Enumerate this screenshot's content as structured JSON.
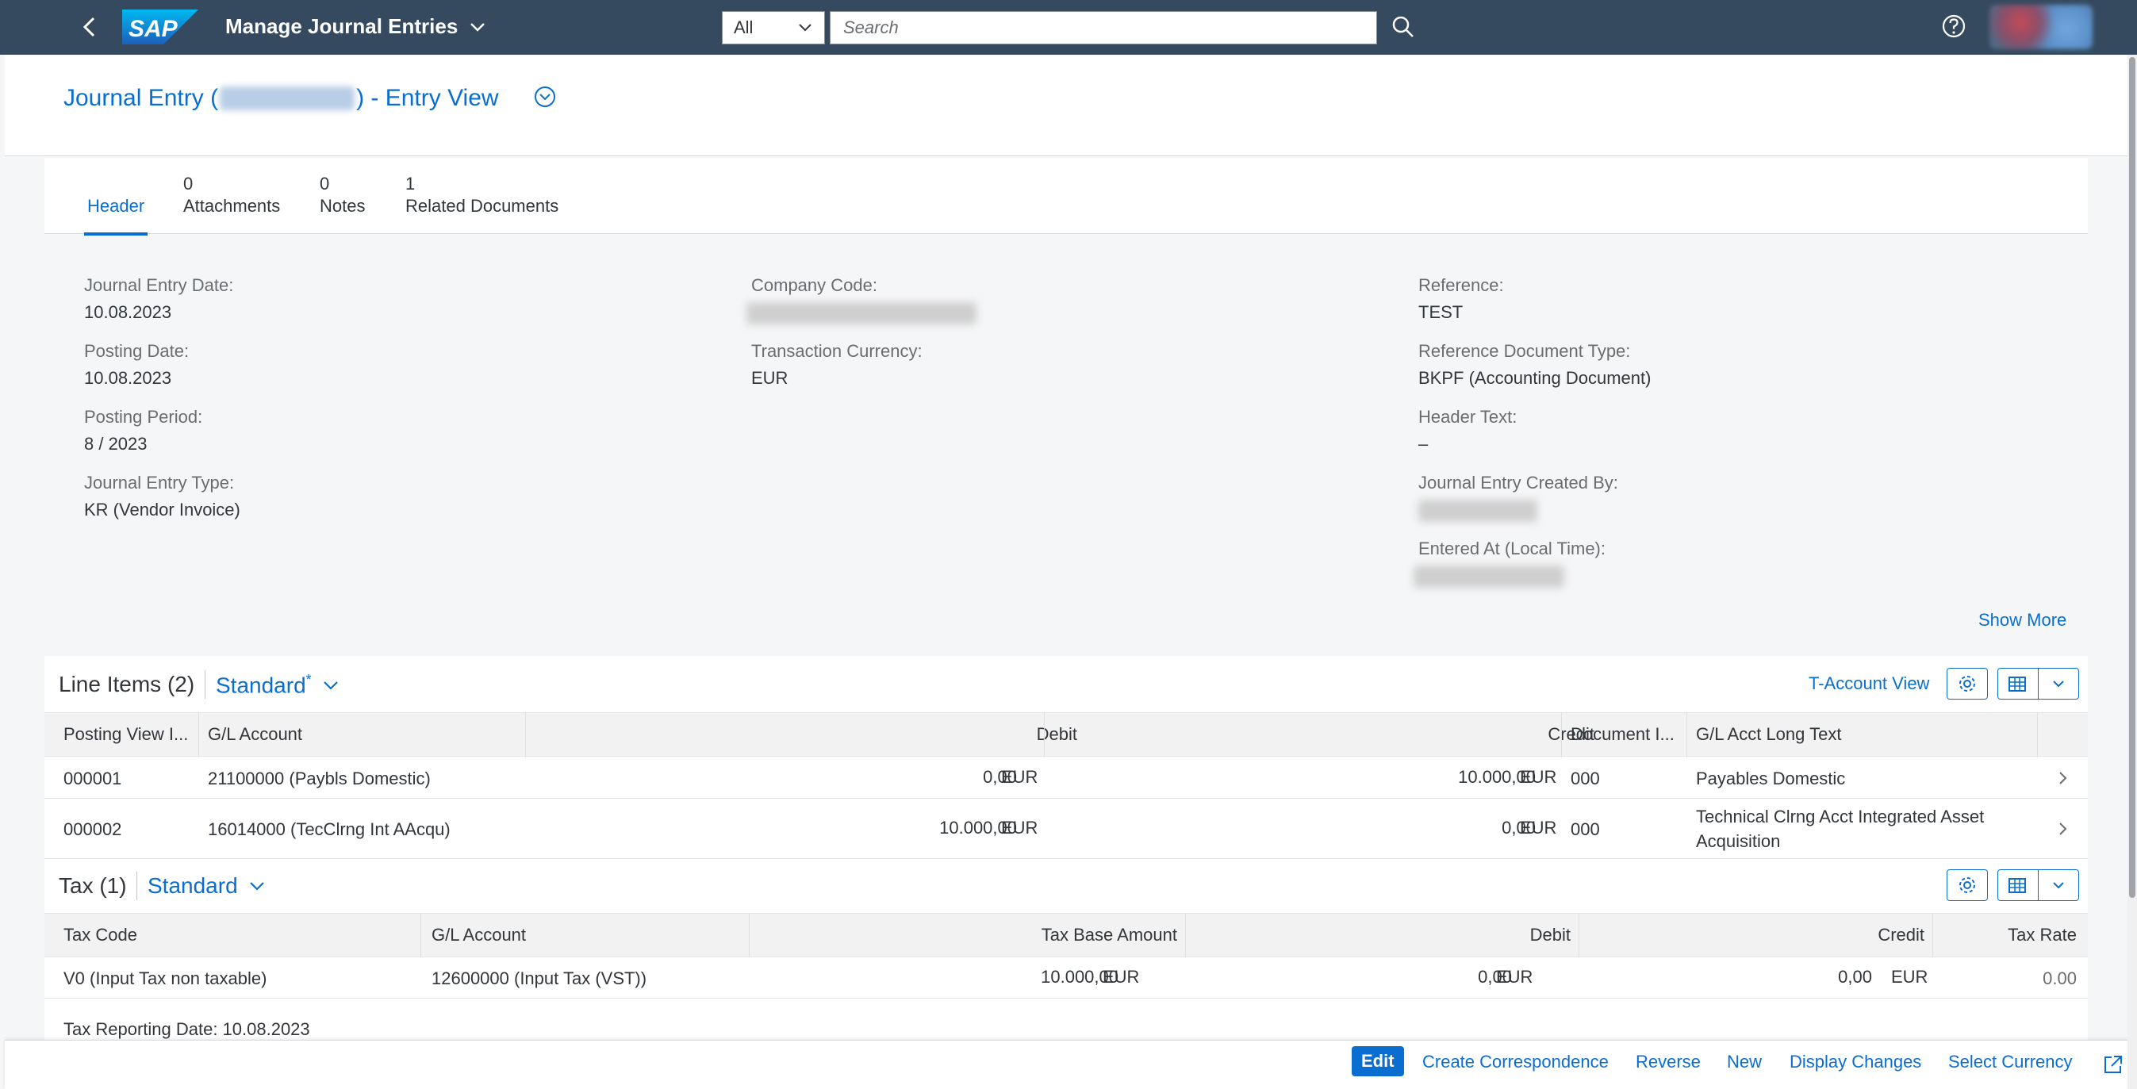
{
  "shell": {
    "app_title": "Manage Journal Entries",
    "logo_text": "SAP",
    "search_scope": "All",
    "search_placeholder": "Search"
  },
  "header": {
    "title_prefix": "Journal Entry (",
    "title_suffix": ") - Entry View"
  },
  "tabs": [
    {
      "count": "",
      "label": "Header"
    },
    {
      "count": "0",
      "label": "Attachments"
    },
    {
      "count": "0",
      "label": "Notes"
    },
    {
      "count": "1",
      "label": "Related Documents"
    }
  ],
  "fields": {
    "journal_entry_date": {
      "label": "Journal Entry Date:",
      "value": "10.08.2023"
    },
    "posting_date": {
      "label": "Posting Date:",
      "value": "10.08.2023"
    },
    "posting_period": {
      "label": "Posting Period:",
      "value": "8 / 2023"
    },
    "journal_entry_type": {
      "label": "Journal Entry Type:",
      "value": "KR (Vendor Invoice)"
    },
    "company_code": {
      "label": "Company Code:"
    },
    "transaction_currency": {
      "label": "Transaction Currency:",
      "value": "EUR"
    },
    "reference": {
      "label": "Reference:",
      "value": "TEST"
    },
    "reference_document_type": {
      "label": "Reference Document Type:",
      "value": "BKPF (Accounting Document)"
    },
    "header_text": {
      "label": "Header Text:",
      "value": "–"
    },
    "created_by": {
      "label": "Journal Entry Created By:"
    },
    "entered_at": {
      "label": "Entered At (Local Time):"
    }
  },
  "show_more": "Show More",
  "line_items": {
    "title": "Line Items (2)",
    "variant": "Standard",
    "variant_modified": "*",
    "t_account_view": "T-Account View",
    "columns": [
      "Posting View I...",
      "G/L Account",
      "Debit",
      "Credit",
      "Document I...",
      "G/L Acct Long Text"
    ],
    "rows": [
      {
        "posting_view_item": "000001",
        "gl_account": "21100000 (Paybls Domestic)",
        "debit": "0,00",
        "debit_cur": "EUR",
        "credit": "10.000,00",
        "credit_cur": "EUR",
        "doc_item": "000",
        "long_text": "Payables Domestic",
        "long_text_2": ""
      },
      {
        "posting_view_item": "000002",
        "gl_account": "16014000 (TecClrng Int AAcqu)",
        "debit": "10.000,00",
        "debit_cur": "EUR",
        "credit": "0,00",
        "credit_cur": "EUR",
        "doc_item": "000",
        "long_text": "Technical Clrng Acct Integrated Asset",
        "long_text_2": "Acquisition"
      }
    ]
  },
  "tax": {
    "title": "Tax (1)",
    "variant": "Standard",
    "columns": [
      "Tax Code",
      "G/L Account",
      "Tax Base Amount",
      "Debit",
      "Credit",
      "Tax Rate"
    ],
    "rows": [
      {
        "tax_code": "V0 (Input Tax non taxable)",
        "gl_account": "12600000 (Input Tax (VST))",
        "base": "10.000,00",
        "base_cur": "EUR",
        "debit": "0,00",
        "debit_cur": "EUR",
        "credit": "0,00",
        "credit_cur": "EUR",
        "rate": "0.00"
      }
    ],
    "reporting_date": "Tax Reporting Date: 10.08.2023"
  },
  "footer": {
    "edit": "Edit",
    "create_correspondence": "Create Correspondence",
    "reverse": "Reverse",
    "new": "New",
    "display_changes": "Display Changes",
    "select_currency": "Select Currency"
  },
  "colors": {
    "shell_bg": "#354a5f",
    "link": "#0a6ed1",
    "text": "#32363a",
    "label": "#6a6d70"
  }
}
